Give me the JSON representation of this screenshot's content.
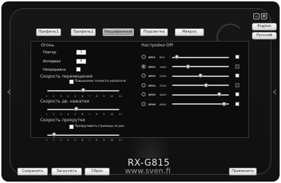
{
  "window": {
    "minimize_label": "–",
    "close_label": "✕"
  },
  "language": {
    "english_label": "English",
    "russian_label": "Русский"
  },
  "tabs": [
    {
      "label": "Профиль1",
      "active": false
    },
    {
      "label": "Профиль2",
      "active": false
    },
    {
      "label": "Расширенный",
      "active": true
    },
    {
      "label": "Подсветка",
      "active": false
    },
    {
      "label": "Макрос",
      "active": false
    }
  ],
  "fire": {
    "title": "Огонь",
    "repeat_label": "Повтор",
    "repeat_value": "5",
    "interval_label": "Интервал",
    "interval_value": "6",
    "continuous_label": "Непрерывно"
  },
  "move_speed": {
    "title": "Скорость перемещения",
    "precision_label": "Повышение точности указателя",
    "value": 6,
    "ticks": [
      "1",
      "2",
      "3",
      "4",
      "5",
      "6",
      "7",
      "8",
      "9",
      "10",
      "11"
    ]
  },
  "dblclick_speed": {
    "title": "Скорость дв. нажатия",
    "value": 5,
    "ticks": [
      "1",
      "2",
      "3",
      "4",
      "5",
      "6",
      "7",
      "8",
      "9",
      "10",
      "11"
    ]
  },
  "scroll_speed": {
    "title": "Скорость прокрутки",
    "page_scroll_label": "Прокручивать страницы за раз",
    "value": 2,
    "ticks": [
      "1",
      "2",
      "3",
      "4",
      "5",
      "6",
      "7",
      "8",
      "9",
      "10",
      "11"
    ]
  },
  "dpi": {
    "title": "Настройки DPI",
    "levels": [
      {
        "name": "DPI1",
        "value": "800",
        "checked": false,
        "fraction": 0.08,
        "indicator": "#ffffff"
      },
      {
        "name": "DPI2",
        "value": "1600",
        "checked": true,
        "fraction": 0.28,
        "indicator": "#2a2a2a"
      },
      {
        "name": "DPI3",
        "value": "2400",
        "checked": false,
        "fraction": 0.5,
        "indicator": "#ffffff"
      },
      {
        "name": "DPI4",
        "value": "3200",
        "checked": false,
        "fraction": 0.6,
        "indicator": "#2a2a2a"
      },
      {
        "name": "DPI5",
        "value": "4800",
        "checked": false,
        "fraction": 0.83,
        "indicator": "#ffffff"
      },
      {
        "name": "DPI6",
        "value": "6400",
        "checked": false,
        "fraction": 0.92,
        "indicator": "#ffffff"
      }
    ]
  },
  "brand": {
    "model": "RX-G815",
    "url": "www.sven.fi"
  },
  "footer": {
    "save_label": "Сохранить проф.",
    "load_label": "Загрузить проф.",
    "reset_label": "Сброс",
    "apply_label": "Применить"
  }
}
